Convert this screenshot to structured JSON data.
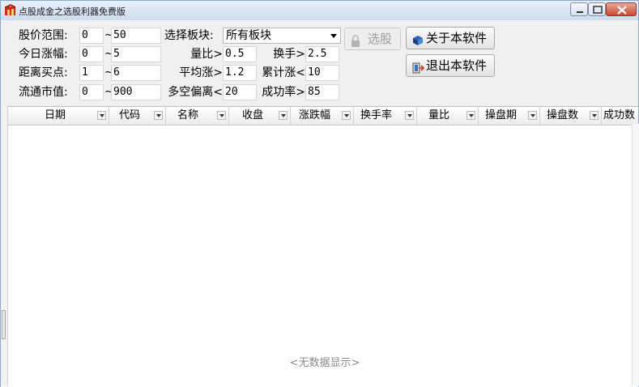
{
  "window": {
    "title": "点股成金之选股利器免费版",
    "controls": [
      "minimize",
      "maximize",
      "close"
    ]
  },
  "filters": {
    "price_range": {
      "label": "股价范围:",
      "min": "0",
      "sep": "~",
      "max": "50"
    },
    "today_change": {
      "label": "今日涨幅:",
      "min": "0",
      "sep": "~",
      "max": "5"
    },
    "dist_buy": {
      "label": "距离买点:",
      "min": "1",
      "sep": "~",
      "max": "6"
    },
    "float_cap": {
      "label": "流通市值:",
      "min": "0",
      "sep": "~",
      "max": "900"
    },
    "sector": {
      "label": "选择板块:",
      "value": "所有板块"
    },
    "volume_ratio": {
      "label": "量比>",
      "value": "0.5"
    },
    "avg_rise": {
      "label": "平均涨>",
      "value": "1.2"
    },
    "deviation": {
      "label": "多空偏离<",
      "value": "20"
    },
    "turnover": {
      "label": "换手>",
      "value": "2.5"
    },
    "cum_rise": {
      "label": "累计涨<",
      "value": "10"
    },
    "success_rate": {
      "label": "成功率>",
      "value": "85"
    }
  },
  "buttons": {
    "select": "选股",
    "about": "关于本软件",
    "exit": "退出本软件"
  },
  "grid": {
    "columns": [
      "日期",
      "代码",
      "名称",
      "收盘",
      "涨跌幅",
      "换手率",
      "量比",
      "操盘期",
      "操盘数",
      "成功数"
    ],
    "empty_text": "<无数据显示>"
  },
  "colors": {
    "titlebar": "#d6e2f2",
    "form_bg": "#f0f0f0",
    "close_button": "#c8472f"
  },
  "icons": {
    "app": "stock-app-icon",
    "select": "lock-icon",
    "about": "book-icon",
    "exit": "exit-door-icon"
  }
}
